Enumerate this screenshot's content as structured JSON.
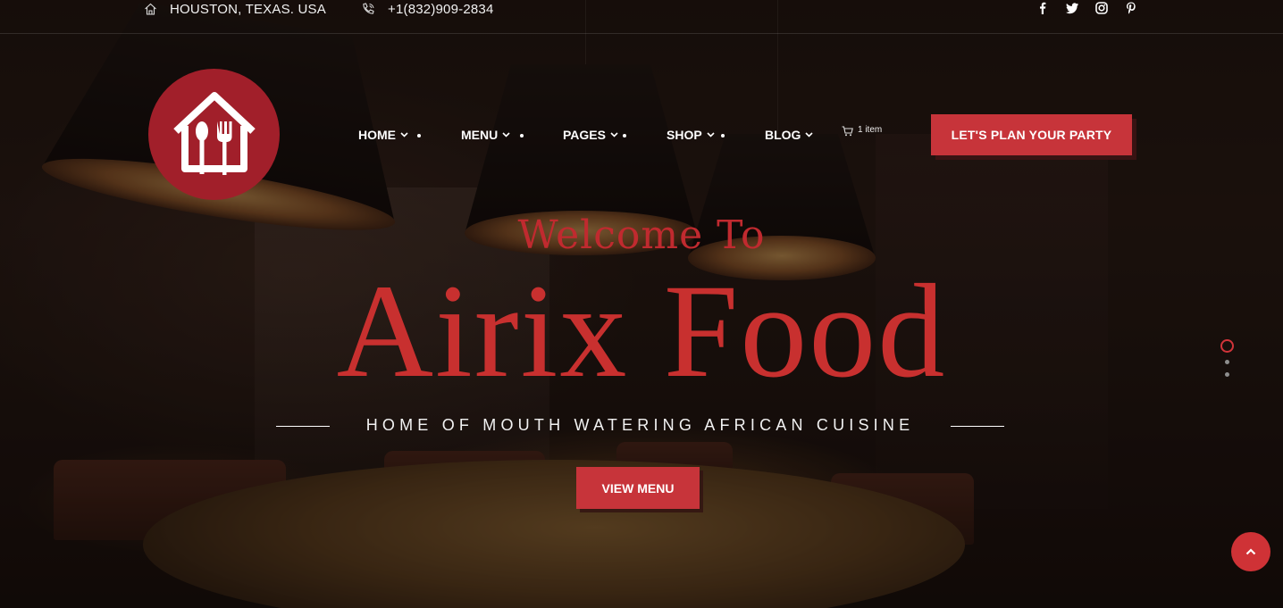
{
  "topbar": {
    "address": "HOUSTON, TEXAS. USA",
    "phone": "+1(832)909-2834",
    "social_icons": [
      "facebook-icon",
      "twitter-icon",
      "instagram-icon",
      "pinterest-icon"
    ]
  },
  "logo": {
    "icon": "house-fork-spoon-icon",
    "color": "#a11f2a"
  },
  "nav": {
    "items": [
      {
        "label": "HOME"
      },
      {
        "label": "MENU"
      },
      {
        "label": "PAGES"
      },
      {
        "label": "SHOP"
      },
      {
        "label": "BLOG"
      }
    ],
    "cart_count": "1 item",
    "cta_label": "LET'S PLAN YOUR PARTY"
  },
  "hero": {
    "welcome": "Welcome To",
    "brand": "Airix Food",
    "tagline": "HOME OF MOUTH WATERING AFRICAN CUISINE",
    "button_label": "VIEW MENU"
  },
  "slider": {
    "slides": 3,
    "active_index": 0
  },
  "colors": {
    "accent": "#c7343a",
    "heading_red": "#c8302f"
  }
}
